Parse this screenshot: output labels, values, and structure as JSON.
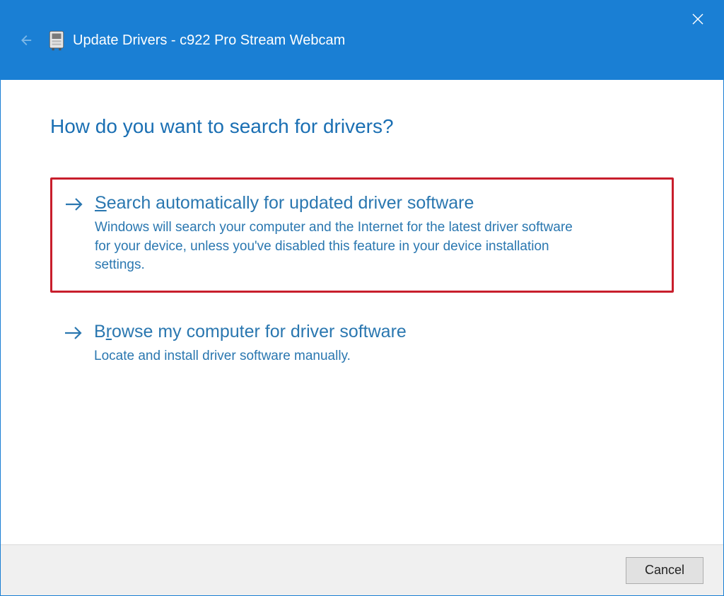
{
  "titlebar": {
    "title": "Update Drivers - c922 Pro Stream Webcam"
  },
  "heading": "How do you want to search for drivers?",
  "options": [
    {
      "accesskey": "S",
      "title_rest": "earch automatically for updated driver software",
      "description": "Windows will search your computer and the Internet for the latest driver software for your device, unless you've disabled this feature in your device installation settings."
    },
    {
      "accesskey_pre": "B",
      "accesskey": "r",
      "title_rest": "owse my computer for driver software",
      "description": "Locate and install driver software manually."
    }
  ],
  "footer": {
    "cancel_label": "Cancel"
  }
}
